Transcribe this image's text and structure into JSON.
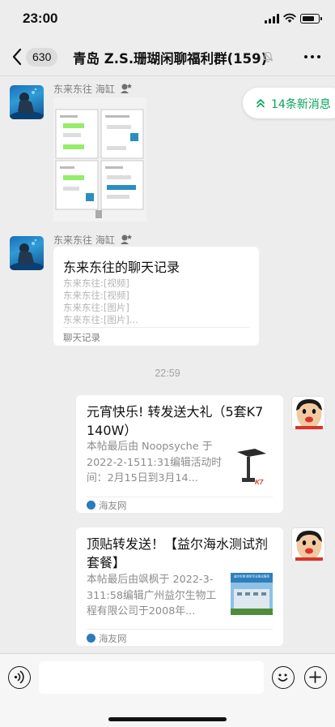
{
  "status_bar": {
    "time": "23:00"
  },
  "nav": {
    "unread_count": "630",
    "title": "青岛 Z.S.珊瑚闲聊福利群(159)"
  },
  "new_messages": {
    "label": "14条新消息"
  },
  "messages": [
    {
      "sender": "东来东往 海缸",
      "type": "image"
    },
    {
      "sender": "东来东往 海缸",
      "type": "chat_record",
      "title": "东来东往的聊天记录",
      "lines": [
        "东来东往:[视频]",
        "东来东往:[视频]",
        "东来东往:[图片]",
        "东来东往:[图片]..."
      ],
      "footer": "聊天记录"
    }
  ],
  "timestamp": "22:59",
  "link_cards": [
    {
      "title": "元宵快乐! 转发送大礼（5套K7 140W）",
      "description": "本帖最后由 Noopsyche 于 2022-2-1511:31编辑活动时间：2月15日到3月14...",
      "source": "海友网"
    },
    {
      "title": "顶贴转发送！【益尔海水测试剂套餐】",
      "description": "本帖最后由飒枫于 2022-3-311:58编辑广州益尔生物工程有限公司于2008年...",
      "source": "海友网",
      "thumb_text": "益尔生物 提供专业测试服务"
    }
  ],
  "colors": {
    "accent_green": "#07a35a",
    "background": "#ededed"
  },
  "icons": [
    "back-icon",
    "mute-icon",
    "more-icon",
    "double-chevron-up-icon",
    "voice-icon",
    "emoji-icon",
    "plus-icon"
  ]
}
